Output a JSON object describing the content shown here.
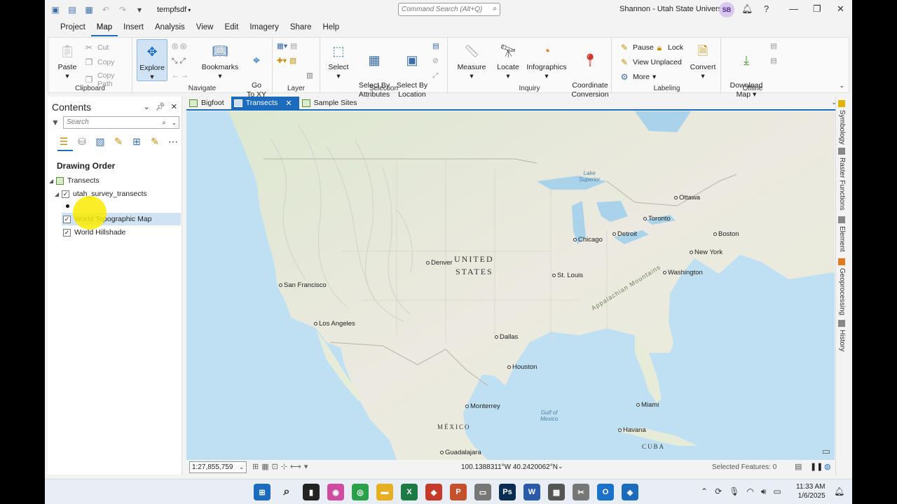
{
  "titlebar": {
    "project_name": "tempfsdf",
    "command_search_placeholder": "Command Search (Alt+Q)",
    "user": "Shannon - Utah State University",
    "avatar_initials": "SB"
  },
  "menu": {
    "tabs": [
      "Project",
      "Map",
      "Insert",
      "Analysis",
      "View",
      "Edit",
      "Imagery",
      "Share",
      "Help"
    ],
    "active": "Map"
  },
  "ribbon": {
    "clipboard": {
      "label": "Clipboard",
      "paste": "Paste",
      "cut": "Cut",
      "copy": "Copy",
      "copy_path": "Copy Path"
    },
    "navigate": {
      "label": "Navigate",
      "explore": "Explore",
      "bookmarks": "Bookmarks",
      "go_to_xy": "Go\nTo XY"
    },
    "layer": {
      "label": "Layer"
    },
    "selection": {
      "label": "Selection",
      "select": "Select",
      "select_by_attributes": "Select By\nAttributes",
      "select_by_location": "Select By\nLocation"
    },
    "inquiry": {
      "label": "Inquiry",
      "measure": "Measure",
      "locate": "Locate",
      "infographics": "Infographics",
      "coordinate_conversion": "Coordinate\nConversion"
    },
    "labeling": {
      "label": "Labeling",
      "pause": "Pause",
      "lock": "Lock",
      "view_unplaced": "View Unplaced",
      "more": "More",
      "convert": "Convert"
    },
    "offline": {
      "label": "Offline",
      "download_map": "Download\nMap"
    }
  },
  "contents": {
    "title": "Contents",
    "search_placeholder": "Search",
    "drawing_order": "Drawing Order",
    "map_name": "Transects",
    "layers": [
      {
        "name": "utah_survey_transects",
        "checked": true
      },
      {
        "name": "World Topographic Map",
        "checked": true,
        "selected": true
      },
      {
        "name": "World Hillshade",
        "checked": true
      }
    ]
  },
  "map_tabs": [
    {
      "label": "Bigfoot",
      "active": false
    },
    {
      "label": "Transects",
      "active": true
    },
    {
      "label": "Sample Sites",
      "active": false
    }
  ],
  "map": {
    "cities": [
      "Ottawa",
      "Toronto",
      "Boston",
      "Detroit",
      "Chicago",
      "New York",
      "Denver",
      "St. Louis",
      "Washington",
      "San Francisco",
      "Los Angeles",
      "Dallas",
      "Houston",
      "Monterrey",
      "Miami",
      "Havana",
      "Guadalajara"
    ],
    "country_us_line1": "UNITED",
    "country_us_line2": "STATES",
    "mexico": "MÉXICO",
    "cuba": "CUBA",
    "lake_superior": "Lake\nSuperior",
    "gulf": "Gulf of\nMexico",
    "appalachian": "Appalachian Mountains"
  },
  "statusbar": {
    "scale": "1:27,855,759",
    "coordinates": "100.1388311°W 40.2420062°N",
    "selected_features": "Selected Features: 0"
  },
  "right_dock": [
    "Symbology",
    "Raster Functions",
    "Element",
    "Geoprocessing",
    "History"
  ],
  "taskbar": {
    "time": "11:33 AM",
    "date": "1/6/2025"
  }
}
